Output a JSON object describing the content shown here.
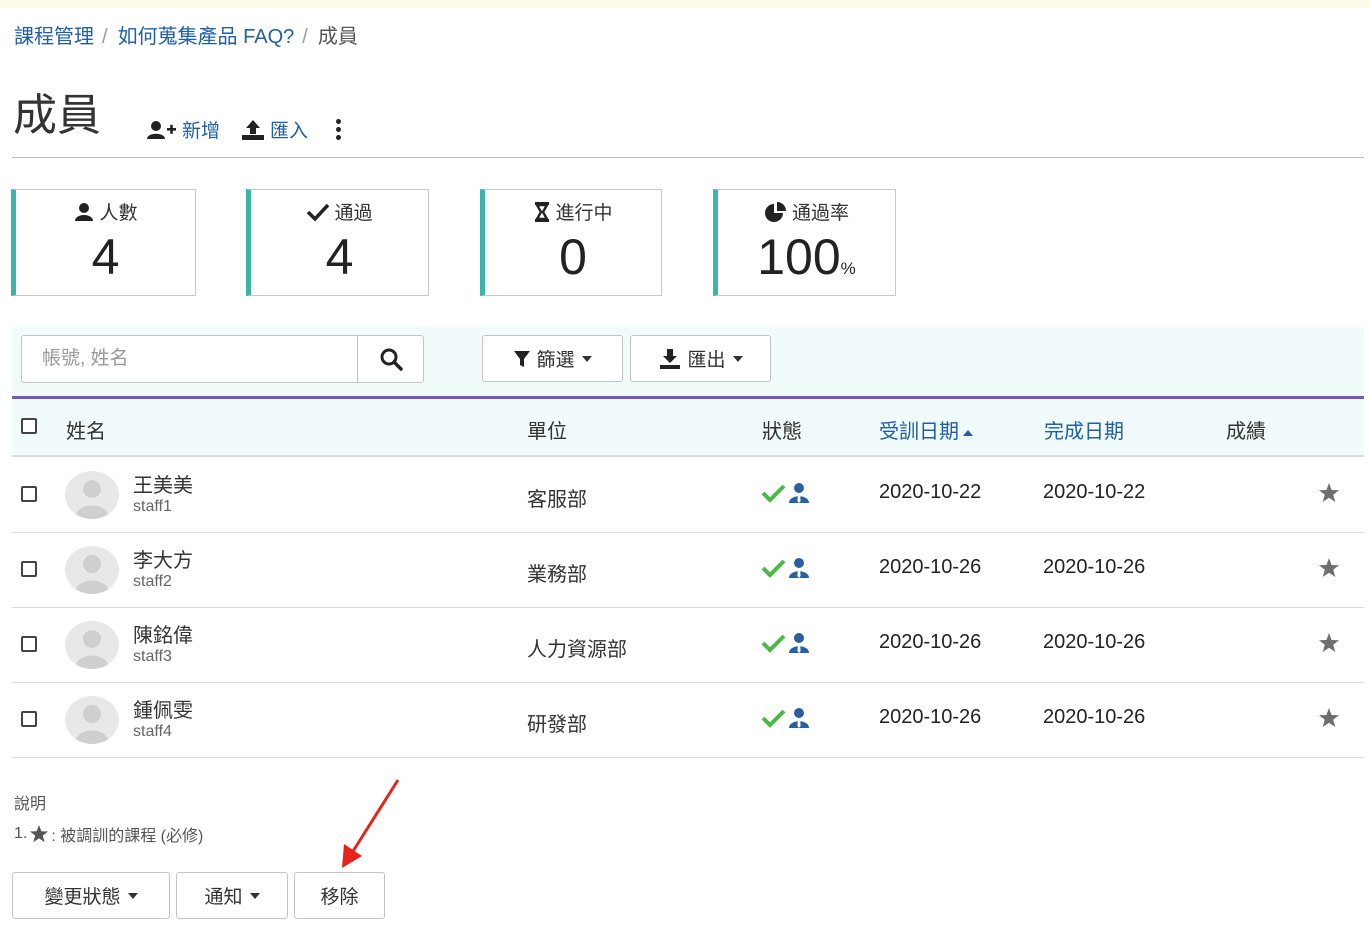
{
  "breadcrumb": {
    "items": [
      "課程管理",
      "如何蒐集產品 FAQ?"
    ],
    "current": "成員",
    "separator": "/"
  },
  "page": {
    "title": "成員",
    "add_label": "新增",
    "import_label": "匯入"
  },
  "stats": [
    {
      "label": "人數",
      "value": "4",
      "unit": "",
      "icon": "user-icon"
    },
    {
      "label": "通過",
      "value": "4",
      "unit": "",
      "icon": "check-icon"
    },
    {
      "label": "進行中",
      "value": "0",
      "unit": "",
      "icon": "hourglass-icon"
    },
    {
      "label": "通過率",
      "value": "100",
      "unit": "%",
      "icon": "pie-chart-icon"
    }
  ],
  "toolbar": {
    "search_placeholder": "帳號, 姓名",
    "filter_label": "篩選",
    "export_label": "匯出"
  },
  "table": {
    "columns": {
      "name": "姓名",
      "unit": "單位",
      "status": "狀態",
      "train_date": "受訓日期",
      "complete_date": "完成日期",
      "score": "成績"
    },
    "sort_column": "train_date",
    "rows": [
      {
        "name": "王美美",
        "account": "staff1",
        "unit": "客服部",
        "train_date": "2020-10-22",
        "complete_date": "2020-10-22"
      },
      {
        "name": "李大方",
        "account": "staff2",
        "unit": "業務部",
        "train_date": "2020-10-26",
        "complete_date": "2020-10-26"
      },
      {
        "name": "陳銘偉",
        "account": "staff3",
        "unit": "人力資源部",
        "train_date": "2020-10-26",
        "complete_date": "2020-10-26"
      },
      {
        "name": "鍾佩雯",
        "account": "staff4",
        "unit": "研發部",
        "train_date": "2020-10-26",
        "complete_date": "2020-10-26"
      }
    ]
  },
  "notes": {
    "title": "說明",
    "prefix": "1.",
    "text": ": 被調訓的課程 (必修)"
  },
  "actions": {
    "change_status_label": "變更狀態",
    "notify_label": "通知",
    "remove_label": "移除"
  },
  "colors": {
    "accent_teal": "#3bb4ad",
    "link_blue": "#1f5fa8",
    "divider_purple": "#7b59b3",
    "pass_green": "#4cb848",
    "annotation_red": "#e8231c"
  }
}
